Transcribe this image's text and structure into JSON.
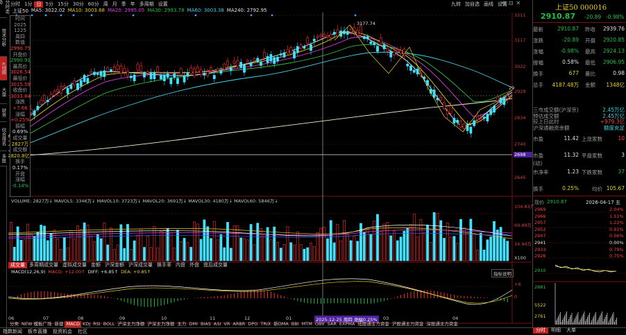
{
  "top_right_tools": [
    "九转",
    "加自选",
    "画线",
    "设置"
  ],
  "side_tabs": [
    "分时走势",
    "技术分析",
    "K线图",
    "大盘",
    "财务",
    "综合排名",
    "多股"
  ],
  "periods": [
    "日线(复权)",
    "5分",
    "1分",
    "日",
    "1周",
    "1月",
    "3月",
    "5分",
    "10分",
    "15分",
    "30分",
    "60分",
    "120分",
    "多周期",
    "设置"
  ],
  "period_labels": [
    "分时",
    "日线",
    "1分",
    "5分",
    "15分",
    "30分",
    "60分",
    "日",
    "周",
    "月",
    "季",
    "年",
    "多周期",
    "设置"
  ],
  "ma_legend": {
    "name": "上证50",
    "ma5": "MA5: 3022.02",
    "ma10": "MA10: 3003.68",
    "ma20": "MA20: 2995.05",
    "ma30": "MA30: 2993.78",
    "ma60": "MA60: 3003.38",
    "ma240": "MA240: 2792.95"
  },
  "info_box": [
    {
      "t": "时间",
      "c": "gry"
    },
    {
      "t": "2025",
      "c": "gry"
    },
    {
      "t": "1225",
      "c": "gry"
    },
    {
      "t": "周四",
      "c": "gry"
    },
    {
      "t": "数值",
      "c": "gry"
    },
    {
      "t": "2990.75",
      "c": "red"
    },
    {
      "t": "开盘价",
      "c": "gry"
    },
    {
      "t": "2990.91",
      "c": "grn"
    },
    {
      "t": "最高价",
      "c": "gry"
    },
    {
      "t": "3026.54",
      "c": "red"
    },
    {
      "t": "最低价",
      "c": "gry"
    },
    {
      "t": "3015.59",
      "c": "red"
    },
    {
      "t": "收盘价",
      "c": "gry"
    },
    {
      "t": "3033.84",
      "c": "red"
    },
    {
      "t": "涨跌",
      "c": "gry"
    },
    {
      "t": "+7.66",
      "c": "red"
    },
    {
      "t": "涨幅",
      "c": "gry"
    },
    {
      "t": "+0.25%",
      "c": "red"
    },
    {
      "t": "振幅",
      "c": "gry"
    },
    {
      "t": "0.69%",
      "c": "wht"
    },
    {
      "t": "成交量",
      "c": "gry"
    },
    {
      "t": "2827万",
      "c": "yel"
    },
    {
      "t": "成交额",
      "c": "gry"
    },
    {
      "t": "820.8亿",
      "c": "yel"
    },
    {
      "t": "换手",
      "c": "gry"
    },
    {
      "t": "0.17%",
      "c": "wht"
    },
    {
      "t": "开盘",
      "c": "gry"
    },
    {
      "t": "涨幅",
      "c": "gry"
    },
    {
      "t": "-0.14%",
      "c": "grn"
    }
  ],
  "price_axis": [
    "3211",
    "3117",
    "3022",
    "2929",
    "2834",
    "2740",
    "2645"
  ],
  "crosshair_price": "2698",
  "peak_label": "3177.74",
  "right_edge_label": "29",
  "vol_legend": "VOLUME: 2827万↓ MAVOL5: 3346万↓ MAVOL10: 3723万↓ MAVOL20: 3691万↓ MAVOL30: 4180万↓ MAVOL60: 5846万↓",
  "vol_axis": [
    "104.83万",
    "69.89万",
    "34.94万",
    "X100"
  ],
  "ind_tabs": [
    "成交量",
    "多周期成交量",
    "虚拟成交量",
    "金额",
    "沪深金额",
    "沪深成交量",
    "换手率",
    "内盘",
    "外盘",
    "盘后成交量"
  ],
  "macd_legend": {
    "name": "MACD(12,26,9)",
    "macd": "MACD: +12.00↑",
    "diff": "DIFF: +6.85↑",
    "dea": "DEA: +0.85↑"
  },
  "macd_btn": "指标说明",
  "macd_axis": [
    "+6",
    "0"
  ],
  "date_axis": [
    "06",
    "07",
    "08",
    "09",
    "10",
    "11",
    "12",
    "01",
    "02",
    "03",
    "04"
  ],
  "cross_date": "2025-12-25 周四 涨幅0.25%",
  "bottom_tabs": [
    {
      "t": "分类",
      "on": false
    },
    {
      "t": "NEW 模板广场",
      "on": false
    },
    {
      "t": "新建",
      "on": false
    },
    {
      "t": "MACD",
      "on": true
    },
    {
      "t": "KDJ",
      "on": false
    },
    {
      "t": "RSI",
      "on": false
    },
    {
      "t": "BOLL",
      "on": false
    },
    {
      "t": "沪深主力净额",
      "on": false
    },
    {
      "t": "沪深主力净额",
      "on": false
    },
    {
      "t": "主力",
      "on": false
    },
    {
      "t": "DMI",
      "on": false
    },
    {
      "t": "BIAS",
      "on": false
    },
    {
      "t": "ASI",
      "on": false
    },
    {
      "t": "VR",
      "on": false
    },
    {
      "t": "ARBR",
      "on": false
    },
    {
      "t": "DPO",
      "on": false
    },
    {
      "t": "TRIX",
      "on": false
    },
    {
      "t": "新DMA",
      "on": false
    },
    {
      "t": "BBI",
      "on": false
    },
    {
      "t": "MTM",
      "on": false
    },
    {
      "t": "OBV",
      "on": false
    },
    {
      "t": "SAR",
      "on": false
    },
    {
      "t": "EXPMA",
      "on": false
    },
    {
      "t": "陆股通主力资金",
      "on": false
    },
    {
      "t": "沪股通主力资金",
      "on": false
    },
    {
      "t": "深股通主力资金",
      "on": false
    }
  ],
  "status_bar": [
    "指数新闻",
    "板市直播",
    "投资机会",
    "社区"
  ],
  "quote": {
    "title": "上证50 000016",
    "price": "2910.87",
    "chg": "-20.89",
    "pct": "-0.98%",
    "rows": [
      {
        "l1": "最新",
        "v1": "2910.87",
        "c1": "grn",
        "l2": "昨收",
        "v2": "2939.76",
        "c2": "wht"
      },
      {
        "l1": "涨跌",
        "v1": "-20.89",
        "c1": "grn",
        "l2": "开盘",
        "v2": "2920.85",
        "c2": "grn"
      },
      {
        "l1": "涨幅",
        "v1": "-0.98%",
        "c1": "grn",
        "l2": "最高",
        "v2": "2924.13",
        "c2": "grn"
      },
      {
        "l1": "振幅",
        "v1": "0.58%",
        "c1": "wht",
        "l2": "最低",
        "v2": "2906.95",
        "c2": "grn"
      },
      {
        "l1": "换手",
        "v1": "677",
        "c1": "yel",
        "l2": "量比",
        "v2": "0.98",
        "c2": "wht"
      },
      {
        "l1": "总手",
        "v1": "4187.48万",
        "c1": "yel",
        "l2": "金额",
        "v2": "1348亿",
        "c2": "yel"
      }
    ],
    "extra": [
      {
        "l": "三市成交额(沪深京)",
        "v": "2.45万亿",
        "c": "cyn"
      },
      {
        "l": "预估成交额",
        "v": "2.45万亿",
        "c": "cyn"
      },
      {
        "l": "较上日此时",
        "v": "+979.3亿",
        "c": "red"
      },
      {
        "l": "沪深通融资余额",
        "v": "额度充足",
        "c": "cyn"
      }
    ],
    "rows2": [
      {
        "l1": "市盈",
        "v1": "11.42",
        "c1": "wht",
        "l2": "上涨家数",
        "v2": "10",
        "c2": "red"
      },
      {
        "l1": "市盈(动)",
        "v1": "11.32",
        "c1": "wht",
        "l2": "平盘家数",
        "v2": "3",
        "c2": "wht"
      },
      {
        "l1": "市净率",
        "v1": "1.23",
        "c1": "wht",
        "l2": "下跌家数",
        "v2": "37",
        "c2": "grn"
      },
      {
        "l1": "换手",
        "v1": "0.25%",
        "c1": "yel",
        "l2": "均价",
        "v2": "105.67",
        "c2": "yel"
      }
    ],
    "mini_header": {
      "l": "现价",
      "v": "2910.87",
      "date": "2026-04-17 五"
    },
    "mini_rows": [
      {
        "p": "2969",
        "pct": "2.04%",
        "c": "red"
      },
      {
        "p": "2966",
        "pct": "1.51%",
        "c": "red"
      },
      {
        "p": "2957",
        "pct": "1.22%",
        "c": "red"
      },
      {
        "p": "2952",
        "pct": "0.91%",
        "c": "red"
      },
      {
        "p": "2947",
        "pct": "0.56%",
        "c": "red"
      },
      {
        "p": "2941",
        "pct": "0.00%",
        "c": "wht"
      },
      {
        "p": "2933",
        "pct": "0.79%",
        "c": "red"
      },
      {
        "p": "2926",
        "pct": "0.75%",
        "c": "red"
      },
      {
        "p": "2910",
        "pct": "",
        "c": "grn"
      },
      {
        "p": "2881",
        "pct": "",
        "c": "grn"
      },
      {
        "p": "5522",
        "pct": "",
        "c": "yel"
      },
      {
        "p": "2761",
        "pct": "",
        "c": "yel"
      }
    ],
    "mini_tabs": [
      "分时",
      "明细",
      "大单"
    ]
  }
}
